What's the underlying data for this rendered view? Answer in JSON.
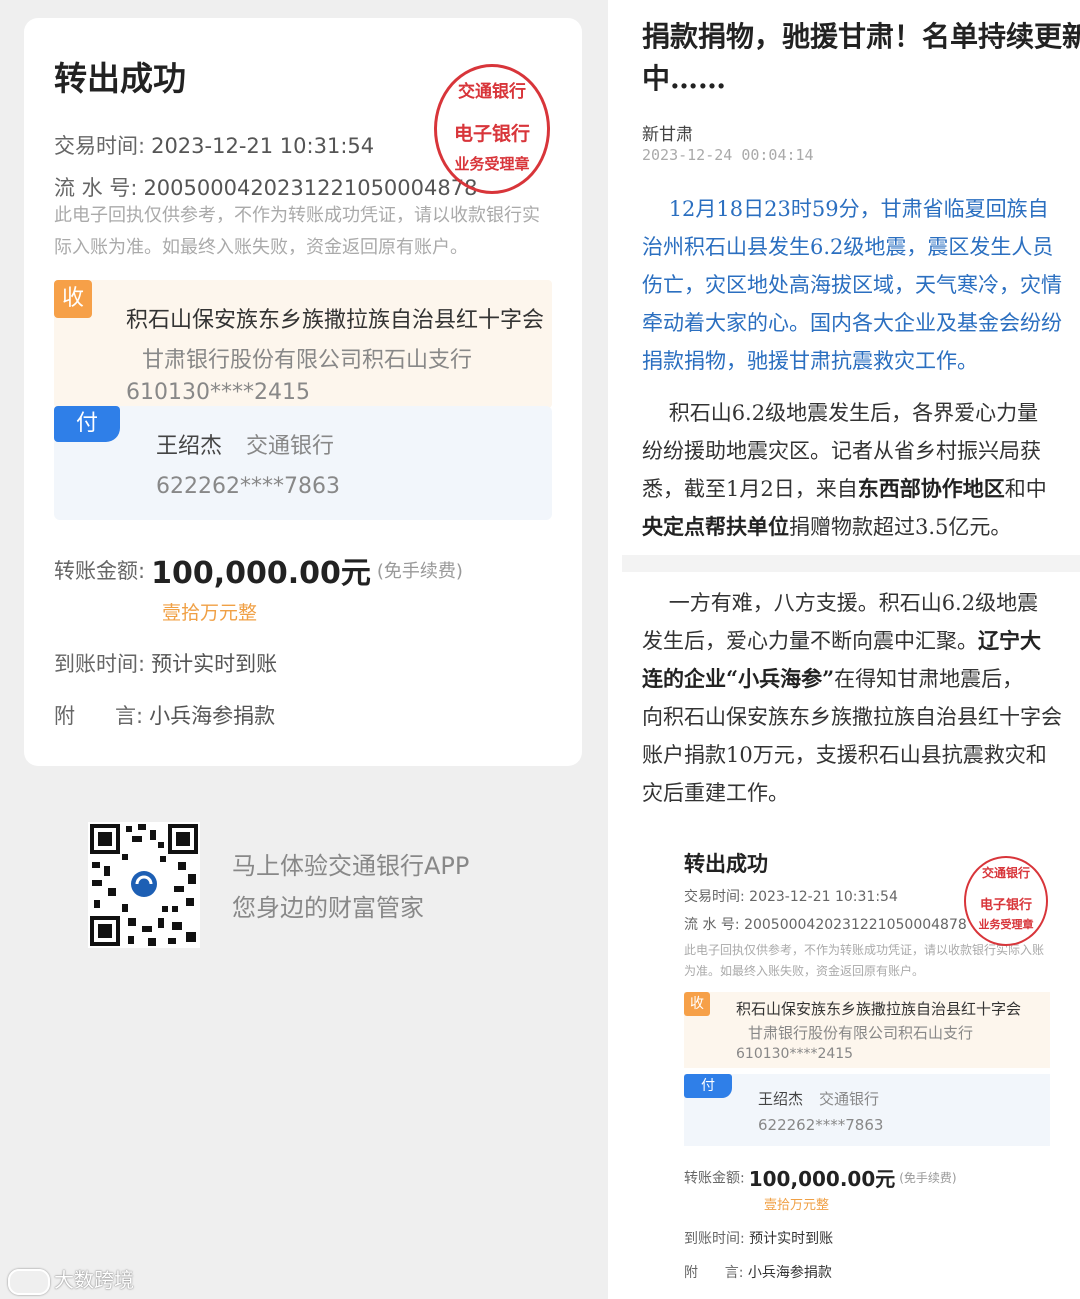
{
  "receipt": {
    "title": "转出成功",
    "time_label": "交易时间:",
    "time_value": "2023-12-21 10:31:54",
    "serial_label": "流 水 号:",
    "serial_value": "2005000420231221050004878",
    "disclaimer": "此电子回执仅供参考，不作为转账成功凭证，请以收款银行实际入账为准。如最终入账失败，资金返回原有账户。",
    "receiver_tag": "收",
    "receiver_name": "积石山保安族东乡族撒拉族自治县红十字会",
    "receiver_bank": "甘肃银行股份有限公司积石山支行",
    "receiver_account": "610130****2415",
    "payer_tag": "付",
    "payer_name": "王绍杰",
    "payer_bank": "交通银行",
    "payer_account": "622262****7863",
    "amount_label": "转账金额:",
    "amount": "100,000.00元",
    "fee_note": "(免手续费)",
    "amount_cn": "壹拾万元整",
    "arrival_label": "到账时间:",
    "arrival_value": "预计实时到账",
    "memo_label": "附      言:",
    "memo_value": "小兵海参捐款",
    "seal": {
      "top": "交通银行",
      "middle": "电子银行",
      "bottom": "业务受理章"
    }
  },
  "promo": {
    "line1": "马上体验交通银行APP",
    "line2": "您身边的财富管家"
  },
  "watermark": "大数跨境",
  "article": {
    "title": "捐款捐物，驰援甘肃！名单持续更新中……",
    "source": "新甘肃",
    "date": "2023-12-24 00:04:14",
    "p1_lines": [
      "    12月18日23时59分，甘肃省临夏回族自",
      "治州积石山县发生6.2级地震，震区发生人员",
      "伤亡，灾区地处高海拔区域，天气寒冷，灾情",
      "牵动着大家的心。国内各大企业及基金会纷纷",
      "捐款捐物，驰援甘肃抗震救灾工作。"
    ],
    "p2_lines": [
      "    积石山6.2级地震发生后，各界爱心力量",
      "纷纷援助地震灾区。记者从省乡村振兴局获",
      "悉，截至1月2日，来自",
      "东西部协作地区",
      "和中",
      "央定点帮扶单位",
      "捐赠物款超过3.5亿元。"
    ],
    "p3_lines": [
      "    一方有难，八方支援。积石山6.2级地震",
      "发生后，爱心力量不断向震中汇聚。",
      "辽宁大",
      "连的企业“小兵海参”",
      "在得知甘肃地震后，",
      "向积石山保安族东乡族撒拉族自治县红十字会",
      "账户捐款10万元，支援积石山县抗震救灾和",
      "灾后重建工作。"
    ]
  },
  "colors": {
    "seal_red": "#d8353a",
    "tag_orange": "#f6a048",
    "tag_blue": "#2f7fe8",
    "article_blue": "#2b6fc0"
  },
  "icons": [
    "qr-code-icon",
    "bank-seal-stamp",
    "watermark-logo-icon"
  ]
}
